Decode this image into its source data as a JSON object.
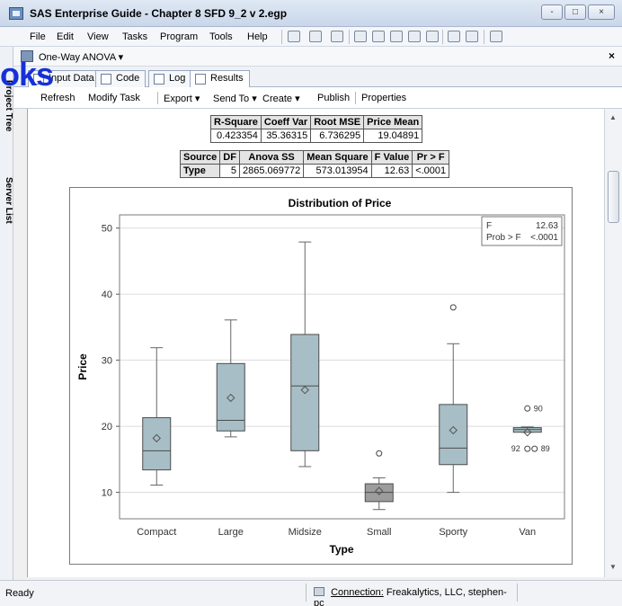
{
  "window": {
    "title": "SAS Enterprise Guide - Chapter 8 SFD 9_2 v 2.egp",
    "controls": [
      "-",
      "□",
      "×"
    ]
  },
  "menubar": {
    "items": [
      "File",
      "Edit",
      "View",
      "Tasks",
      "Program",
      "Tools",
      "Help"
    ]
  },
  "sidebar": {
    "tabs": [
      "Project Tree",
      "Server List"
    ]
  },
  "document": {
    "title": "One-Way ANOVA ▾",
    "close_label": "×"
  },
  "tabs": [
    {
      "label": "Input Data"
    },
    {
      "label": "Code"
    },
    {
      "label": "Log"
    },
    {
      "label": "Results"
    }
  ],
  "taskbar": {
    "items": [
      "Refresh",
      "Modify Task",
      "Export ▾",
      "Send To ▾",
      "Create ▾",
      "Publish",
      "Properties"
    ]
  },
  "fit_table": {
    "headers": [
      "R-Square",
      "Coeff Var",
      "Root MSE",
      "Price Mean"
    ],
    "row": [
      "0.423354",
      "35.36315",
      "6.736295",
      "19.04891"
    ]
  },
  "anova_table": {
    "headers": [
      "Source",
      "DF",
      "Anova SS",
      "Mean Square",
      "F Value",
      "Pr > F"
    ],
    "row": [
      "Type",
      "5",
      "2865.069772",
      "573.013954",
      "12.63",
      "<.0001"
    ]
  },
  "chart_data": {
    "type": "box",
    "title": "Distribution of Price",
    "xlabel": "Type",
    "ylabel": "Price",
    "ylim": [
      6,
      52
    ],
    "yticks": [
      10,
      20,
      30,
      40,
      50
    ],
    "categories": [
      "Compact",
      "Large",
      "Midsize",
      "Small",
      "Sporty",
      "Van"
    ],
    "boxes": [
      {
        "category": "Compact",
        "min": 11.1,
        "q1": 13.4,
        "median": 16.3,
        "q3": 21.3,
        "max": 31.9,
        "mean": 18.2,
        "outliers": []
      },
      {
        "category": "Large",
        "min": 18.4,
        "q1": 19.3,
        "median": 20.9,
        "q3": 29.5,
        "max": 36.1,
        "mean": 24.3,
        "outliers": []
      },
      {
        "category": "Midsize",
        "min": 13.9,
        "q1": 16.3,
        "median": 26.1,
        "q3": 33.9,
        "max": 47.9,
        "mean": 25.5,
        "outliers": []
      },
      {
        "category": "Small",
        "min": 7.4,
        "q1": 8.6,
        "median": 10.0,
        "q3": 11.3,
        "max": 12.2,
        "mean": 10.2,
        "outliers": [
          {
            "value": 15.9,
            "label": ""
          }
        ]
      },
      {
        "category": "Sporty",
        "min": 10.0,
        "q1": 14.2,
        "median": 16.7,
        "q3": 23.3,
        "max": 32.5,
        "mean": 19.4,
        "outliers": [
          {
            "value": 38.0,
            "label": ""
          }
        ]
      },
      {
        "category": "Van",
        "min": 19.1,
        "q1": 19.1,
        "median": 19.5,
        "q3": 19.8,
        "max": 19.9,
        "mean": 19.1,
        "outliers": [
          {
            "value": 22.7,
            "label": "90"
          },
          {
            "value": 16.6,
            "label": "92"
          },
          {
            "value": 16.6,
            "label": "89"
          }
        ]
      }
    ],
    "legend": {
      "position": "top-right",
      "lines": [
        [
          "F",
          "12.63"
        ],
        [
          "Prob > F",
          "<.0001"
        ]
      ]
    }
  },
  "status": {
    "left": "Ready",
    "connection_label": "Connection:",
    "connection_value": "Freakalytics, LLC, stephen-pc"
  },
  "overlay": {
    "brand": "oks"
  },
  "colors": {
    "box_fill": "#a7bec6",
    "small_box_fill": "#9c9c9c",
    "frame": "#7b7b7b"
  }
}
